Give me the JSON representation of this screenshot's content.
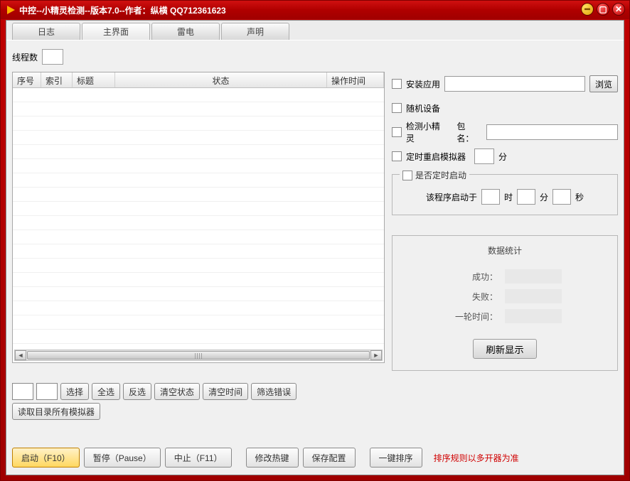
{
  "window": {
    "title": "中控--小精灵检测--版本7.0--作者：纵横 QQ712361623"
  },
  "tabs": [
    "日志",
    "主界面",
    "雷电",
    "声明"
  ],
  "thread_label": "线程数",
  "grid": {
    "headers": {
      "seq": "序号",
      "idx": "索引",
      "title": "标题",
      "status": "状态",
      "time": "操作时间"
    }
  },
  "left_buttons": {
    "select": "选择",
    "all": "全选",
    "invert": "反选",
    "clear_status": "清空状态",
    "clear_time": "清空时间",
    "filter_error": "筛选错误",
    "read_all": "读取目录所有模拟器"
  },
  "right": {
    "install_app": "安装应用",
    "browse": "浏览",
    "random_device": "随机设备",
    "detect_sprite": "检测小精灵",
    "pkg_label": "包名：",
    "timed_restart": "定时重启模拟器",
    "minute_unit": "分",
    "timed_start_legend": "是否定时启动",
    "program_start_at": "该程序启动于",
    "hour_unit": "时",
    "sec_unit": "秒",
    "stats_title": "数据统计",
    "success_label": "成功：",
    "fail_label": "失败：",
    "round_time_label": "一轮时间：",
    "refresh": "刷新显示"
  },
  "bottom": {
    "start": "启动（F10）",
    "pause": "暂停（Pause）",
    "stop": "中止（F11）",
    "hotkey": "修改热键",
    "save_cfg": "保存配置",
    "one_sort": "一键排序",
    "sort_note": "排序规则以多开器为准"
  }
}
